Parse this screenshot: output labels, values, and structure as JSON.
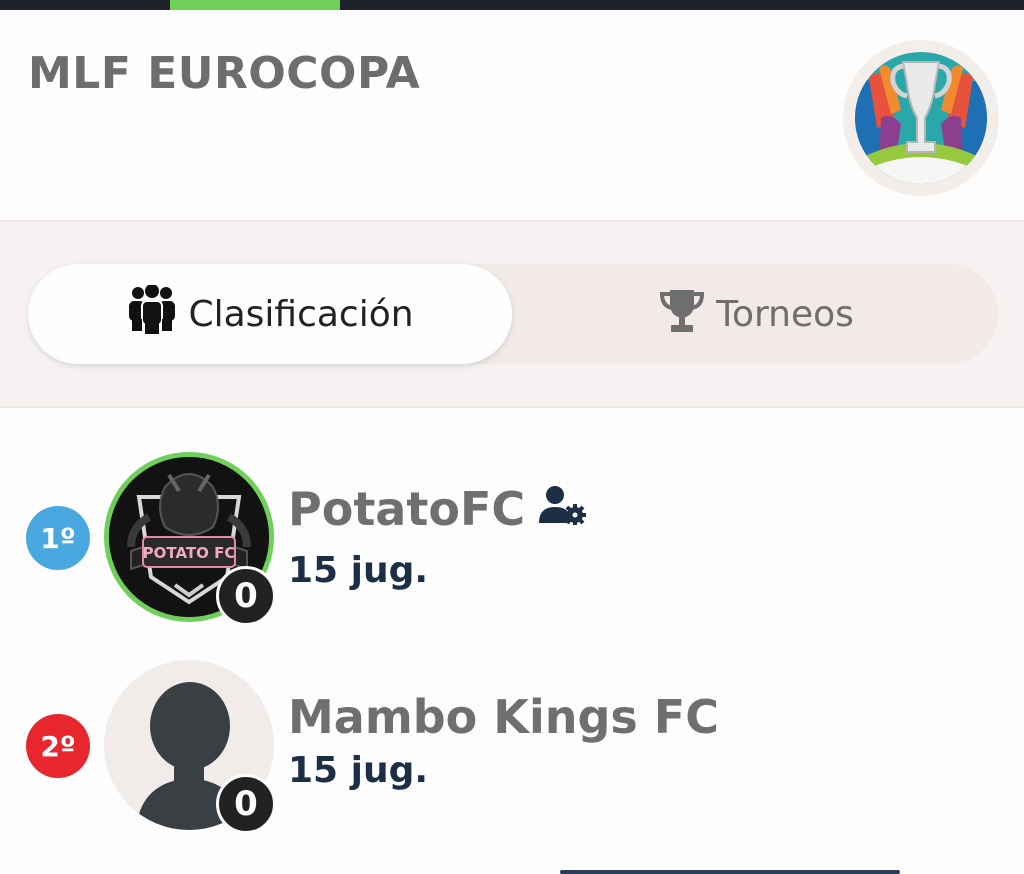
{
  "header": {
    "title": "MLF EUROCOPA",
    "logo_icon": "euro-trophy-logo-icon"
  },
  "tabs": [
    {
      "label": "Clasificación",
      "icon": "group-users-icon",
      "active": true
    },
    {
      "label": "Torneos",
      "icon": "trophy-icon",
      "active": false
    }
  ],
  "standings": [
    {
      "rank": "1º",
      "rank_color": "#4aa8e0",
      "team": "PotatoFC",
      "players": "15 jug.",
      "score": "0",
      "avatar_text": "POTATO FC",
      "admin_icon": "user-gear-icon"
    },
    {
      "rank": "2º",
      "rank_color": "#e8262d",
      "team": "Mambo Kings FC",
      "players": "15 jug.",
      "score": "0"
    }
  ],
  "colors": {
    "accent_green": "#6fcf58",
    "dark_navy": "#1c2f45",
    "title_gray": "#6d6d6d"
  }
}
